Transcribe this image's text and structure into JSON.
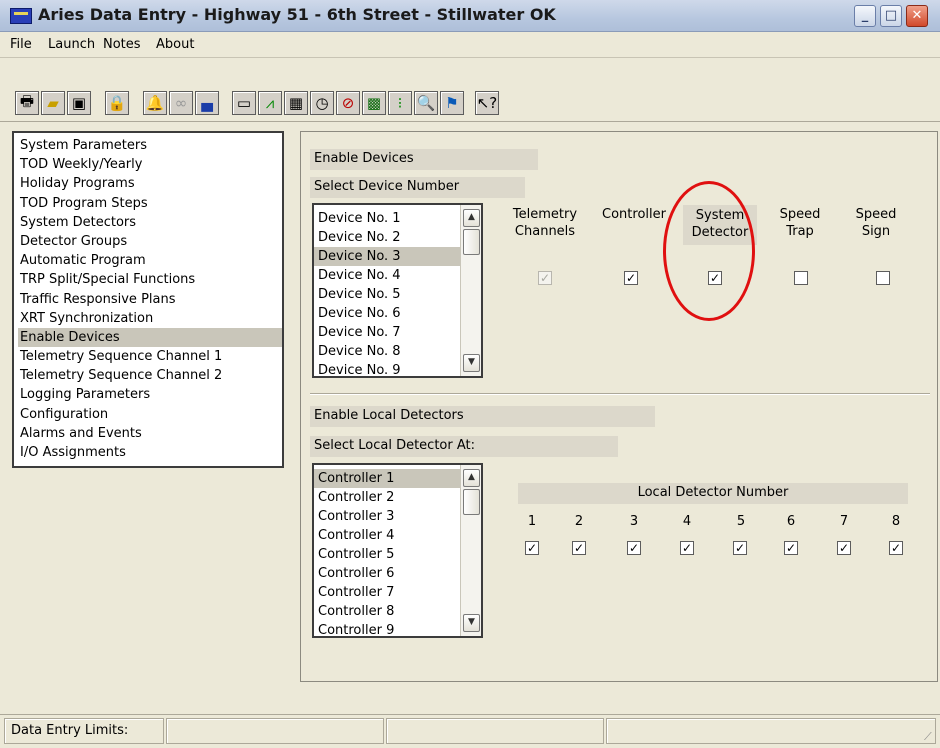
{
  "window": {
    "title": "Aries Data Entry - Highway 51 - 6th Street - Stillwater OK",
    "controls": [
      "minimize",
      "maximize",
      "close"
    ]
  },
  "menu": [
    "File",
    "Launch",
    "Notes",
    "About"
  ],
  "toolbar": {
    "icons": [
      "printer-icon",
      "open-folder-icon",
      "save-disk-icon",
      "padlock-icon",
      "bell-icon",
      "glasses-icon",
      "loader-icon",
      "monitor-icon",
      "chart-icon",
      "grid-icon",
      "clock-icon",
      "phase-icon",
      "detector-icon",
      "traffic-light-icon",
      "zoom-icon",
      "flag-icon",
      "help-icon"
    ]
  },
  "nav": {
    "items": [
      "System Parameters",
      "TOD Weekly/Yearly",
      "Holiday Programs",
      "TOD Program Steps",
      "System Detectors",
      "Detector Groups",
      "Automatic Program",
      "TRP Split/Special Functions",
      "Traffic Responsive Plans",
      "XRT Synchronization",
      "Enable Devices",
      "Telemetry Sequence Channel 1",
      "Telemetry Sequence Channel 2",
      "Logging Parameters",
      "Configuration",
      "Alarms and Events",
      "I/O Assignments"
    ],
    "selected": "Enable Devices"
  },
  "enable_devices": {
    "section_label": "Enable Devices",
    "select_label": "Select Device Number",
    "devices": [
      "Device No. 1",
      "Device No. 2",
      "Device No. 3",
      "Device No. 4",
      "Device No. 5",
      "Device No. 6",
      "Device No. 7",
      "Device No. 8",
      "Device No. 9"
    ],
    "selected_device": "Device No. 3",
    "columns": [
      {
        "line1": "Telemetry",
        "line2": "Channels",
        "checked": true,
        "enabled": false
      },
      {
        "line1": "Controller",
        "line2": "",
        "checked": true,
        "enabled": true
      },
      {
        "line1": "System",
        "line2": "Detector",
        "checked": true,
        "enabled": true
      },
      {
        "line1": "Speed",
        "line2": "Trap",
        "checked": false,
        "enabled": true
      },
      {
        "line1": "Speed",
        "line2": "Sign",
        "checked": false,
        "enabled": true
      }
    ]
  },
  "local_detectors": {
    "section_label": "Enable Local Detectors",
    "select_label": "Select Local Detector At:",
    "controllers": [
      "Controller 1",
      "Controller 2",
      "Controller 3",
      "Controller 4",
      "Controller 5",
      "Controller 6",
      "Controller 7",
      "Controller 8",
      "Controller 9"
    ],
    "selected_controller": "Controller 1",
    "number_label": "Local Detector Number",
    "detectors": [
      "1",
      "2",
      "3",
      "4",
      "5",
      "6",
      "7",
      "8"
    ],
    "detector_checked": [
      true,
      true,
      true,
      true,
      true,
      true,
      true,
      true
    ]
  },
  "annotation": {
    "color": "#e01010"
  },
  "statusbar": {
    "label": "Data Entry Limits:"
  },
  "colors": {
    "selection": "#c9c6ba",
    "panel": "#ece9d8",
    "label_band": "#dcd8cb"
  }
}
